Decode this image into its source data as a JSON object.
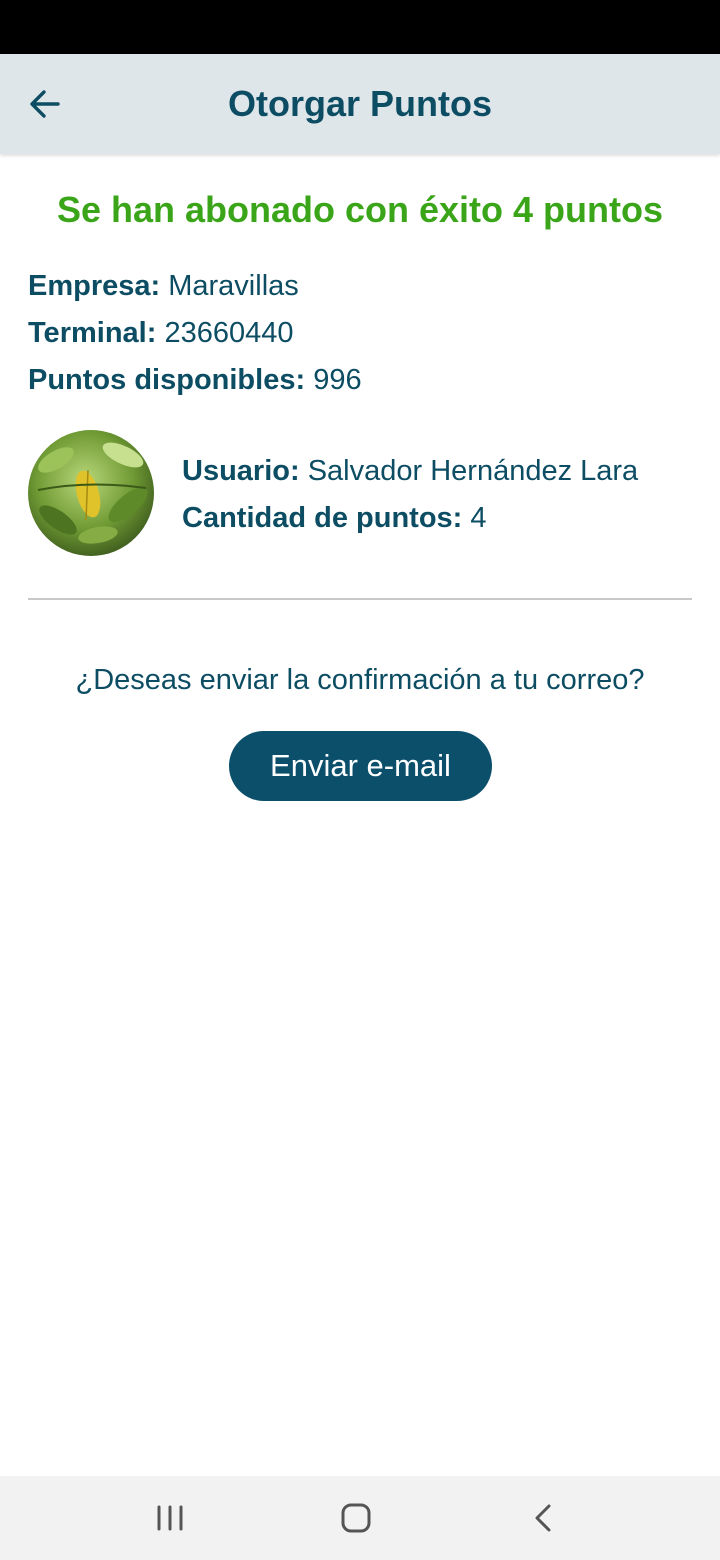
{
  "app_bar": {
    "title": "Otorgar Puntos",
    "back_icon": "arrow-left-icon"
  },
  "success_message": "Se han abonado con éxito 4 puntos",
  "details": {
    "empresa_label": "Empresa:",
    "empresa_value": "Maravillas",
    "terminal_label": "Terminal:",
    "terminal_value": "23660440",
    "puntos_label": "Puntos disponibles:",
    "puntos_value": "996"
  },
  "user": {
    "avatar_icon": "leaf-photo-avatar",
    "usuario_label": "Usuario:",
    "usuario_value": "Salvador Hernández Lara",
    "cantidad_label": "Cantidad de puntos:",
    "cantidad_value": "4"
  },
  "email_prompt": {
    "question": "¿Deseas enviar la confirmación a tu correo?",
    "button_label": "Enviar e-mail"
  },
  "system_nav": {
    "recents_icon": "recents-icon",
    "home_icon": "home-icon",
    "back_icon": "back-chevron-icon"
  },
  "colors": {
    "primary": "#0d4d63",
    "success": "#3aa519",
    "button": "#0b4f6b",
    "app_bar_bg": "#dfe6e9"
  }
}
